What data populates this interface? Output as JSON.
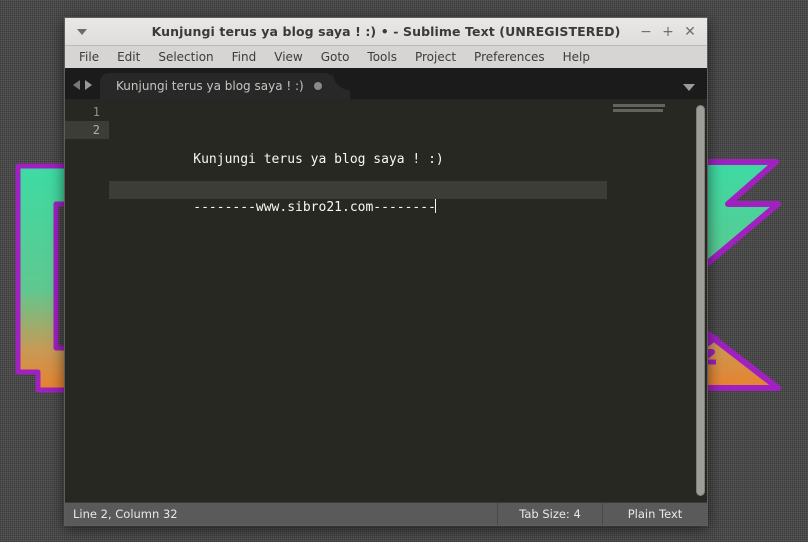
{
  "window": {
    "title": "Kunjungi terus ya blog saya ! :) • - Sublime Text (UNREGISTERED)",
    "menu_button_icon": "chevron-down-icon",
    "controls": {
      "minimize": "−",
      "maximize": "+",
      "close": "✕"
    }
  },
  "menubar": {
    "items": [
      {
        "label": "File"
      },
      {
        "label": "Edit"
      },
      {
        "label": "Selection"
      },
      {
        "label": "Find"
      },
      {
        "label": "View"
      },
      {
        "label": "Goto"
      },
      {
        "label": "Tools"
      },
      {
        "label": "Project"
      },
      {
        "label": "Preferences"
      },
      {
        "label": "Help"
      }
    ]
  },
  "tabbar": {
    "prev_icon": "triangle-left-icon",
    "next_icon": "triangle-right-icon",
    "dropdown_icon": "chevron-down-icon",
    "tabs": [
      {
        "label": "Kunjungi terus ya blog saya ! :)",
        "modified": true,
        "modified_icon": "unsaved-dot-icon"
      }
    ]
  },
  "editor": {
    "lines": [
      {
        "number": "1",
        "text": "Kunjungi terus ya blog saya ! :)",
        "current": false
      },
      {
        "number": "2",
        "text": "--------www.sibro21.com--------",
        "current": true
      }
    ],
    "caret_line": 2,
    "caret_column": 32
  },
  "statusbar": {
    "position": "Line 2, Column 32",
    "tab_size": "Tab Size: 4",
    "syntax": "Plain Text"
  },
  "theme": {
    "editor_bg": "#272822",
    "editor_fg": "#f8f8f2",
    "gutter_fg": "#8f908a",
    "current_line_bg": "#3c3d36",
    "tabbar_bg": "#1b1b1b",
    "statusbar_bg": "#5a5a5a",
    "titlebar_bg": "#e3e2e0",
    "menubar_bg": "#d6d5d3",
    "wallpaper_bg": "#4b4b4b",
    "wall_accent_top": "#3ddba4",
    "wall_accent_bottom": "#e8822f",
    "wall_outline": "#a020c0"
  }
}
